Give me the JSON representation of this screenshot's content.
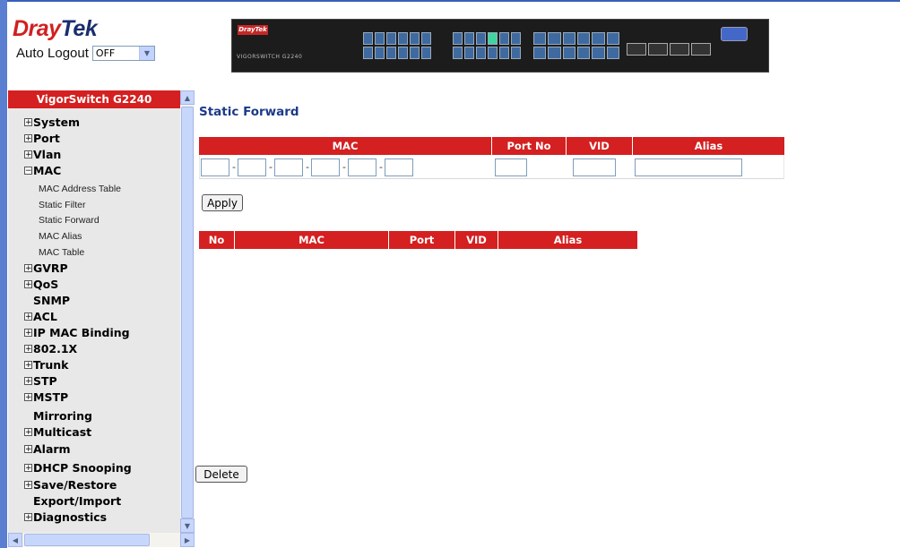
{
  "brand": {
    "logo_prefix": "Dray",
    "logo_suffix": "Tek"
  },
  "auto_logout": {
    "label": "Auto Logout",
    "selected": "OFF"
  },
  "device_image": {
    "brand_text": "DrayTek",
    "model_text": "VIGORSWITCH G2240"
  },
  "sidebar": {
    "title": "VigorSwitch G2240",
    "items": [
      {
        "label": "System",
        "expand": "+"
      },
      {
        "label": "Port",
        "expand": "+"
      },
      {
        "label": "Vlan",
        "expand": "+"
      },
      {
        "label": "MAC",
        "expand": "−",
        "children": [
          "MAC Address Table",
          "Static Filter",
          "Static Forward",
          "MAC Alias",
          "MAC Table"
        ]
      },
      {
        "label": "GVRP",
        "expand": "+"
      },
      {
        "label": "QoS",
        "expand": "+"
      },
      {
        "label": "SNMP",
        "expand": ""
      },
      {
        "label": "ACL",
        "expand": "+"
      },
      {
        "label": "IP MAC Binding",
        "expand": "+"
      },
      {
        "label": "802.1X",
        "expand": "+"
      },
      {
        "label": "Trunk",
        "expand": "+"
      },
      {
        "label": "STP",
        "expand": "+"
      },
      {
        "label": "MSTP",
        "expand": "+"
      },
      {
        "label": "Mirroring",
        "expand": ""
      },
      {
        "label": "Multicast",
        "expand": "+"
      },
      {
        "label": "Alarm",
        "expand": "+"
      },
      {
        "label": "DHCP Snooping",
        "expand": "+"
      },
      {
        "label": "Save/Restore",
        "expand": "+"
      },
      {
        "label": "Export/Import",
        "expand": ""
      },
      {
        "label": "Diagnostics",
        "expand": "+"
      }
    ]
  },
  "main": {
    "title": "Static Forward",
    "form_headers": {
      "mac": "MAC",
      "port_no": "Port No",
      "vid": "VID",
      "alias": "Alias"
    },
    "mac_separator": "-",
    "apply_label": "Apply",
    "list_headers": {
      "no": "No",
      "mac": "MAC",
      "port": "Port",
      "vid": "VID",
      "alias": "Alias"
    },
    "delete_label": "Delete"
  },
  "colors": {
    "header_red": "#d42020",
    "title_blue": "#1c3a8a"
  }
}
